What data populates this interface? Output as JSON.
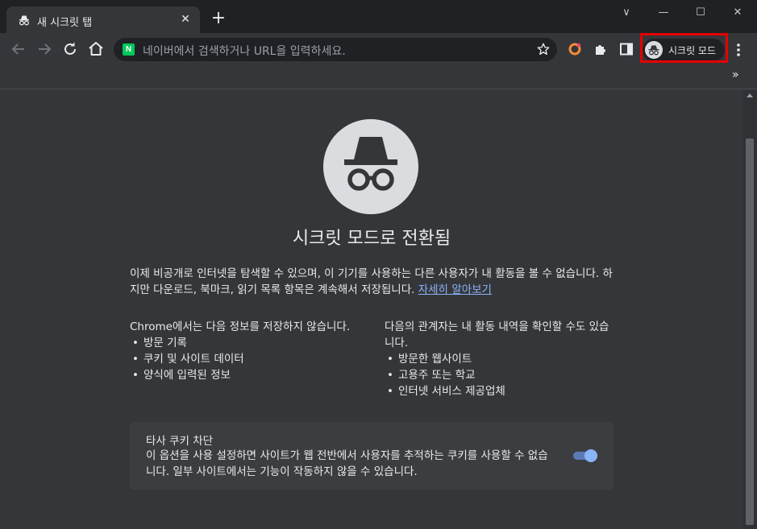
{
  "tab": {
    "title": "새 시크릿 탭",
    "close": "✕",
    "new_tab": "+"
  },
  "window": {
    "chevron": "∨",
    "minimize": "—",
    "maximize": "☐",
    "close": "✕"
  },
  "omnibox": {
    "site_badge": "N",
    "placeholder": "네이버에서 검색하거나 URL을 입력하세요."
  },
  "profile_chip": {
    "label": "시크릿 모드"
  },
  "bookmarks": {
    "overflow": "»"
  },
  "page": {
    "heading": "시크릿 모드로 전환됨",
    "intro": "이제 비공개로 인터넷을 탐색할 수 있으며, 이 기기를 사용하는 다른 사용자가 내 활동을 볼 수 없습니다. 하지만 다운로드, 북마크, 읽기 목록 항목은 계속해서 저장됩니다.",
    "learn_more": "자세히 알아보기",
    "left_col": {
      "title": "Chrome에서는 다음 정보를 저장하지 않습니다.",
      "items": [
        "방문 기록",
        "쿠키 및 사이트 데이터",
        "양식에 입력된 정보"
      ]
    },
    "right_col": {
      "title": "다음의 관계자는 내 활동 내역을 확인할 수도 있습니다.",
      "items": [
        "방문한 웹사이트",
        "고용주 또는 학교",
        "인터넷 서비스 제공업체"
      ]
    },
    "cookie_card": {
      "title": "타사 쿠키 차단",
      "description": "이 옵션을 사용 설정하면 사이트가 웹 전반에서 사용자를 추적하는 쿠키를 사용할 수 없습니다. 일부 사이트에서는 기능이 작동하지 않을 수 있습니다.",
      "toggle_on": true
    }
  },
  "colors": {
    "accent": "#8ab4f8",
    "highlight": "#e50000",
    "naver": "#03c75a"
  }
}
